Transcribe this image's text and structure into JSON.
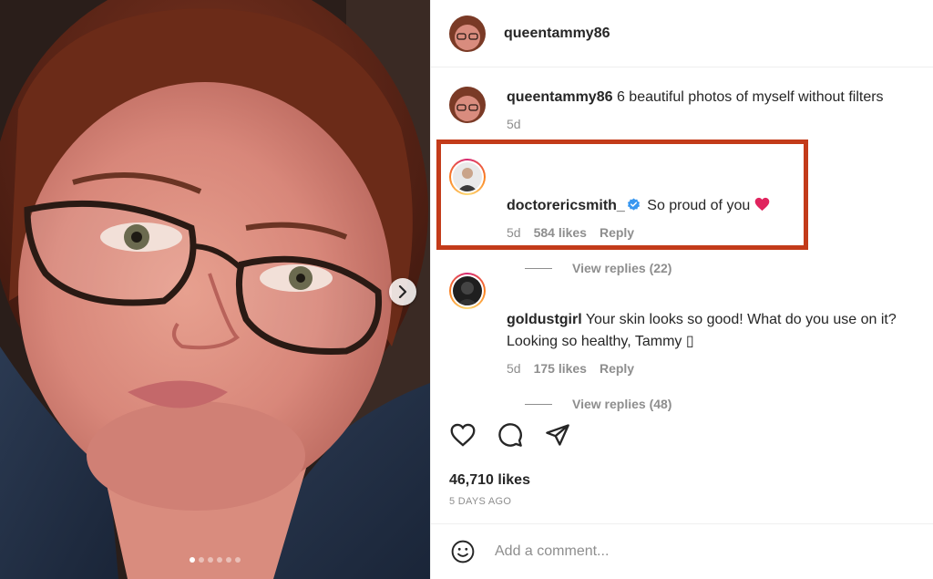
{
  "post": {
    "author": "queentammy86",
    "caption_user": "queentammy86",
    "caption_text": "6 beautiful photos of myself without filters",
    "caption_age": "5d",
    "photo_count": 6,
    "active_photo_index": 0
  },
  "comments": [
    {
      "username": "doctorericsmith_",
      "verified": true,
      "text": "So proud of you",
      "age": "5d",
      "likes": "584 likes",
      "reply_label": "Reply",
      "view_replies": "View replies (22)"
    },
    {
      "username": "goldustgirl",
      "verified": false,
      "text": "Your skin looks so good! What do you use on it? Looking so healthy, Tammy ▯",
      "age": "5d",
      "likes": "175 likes",
      "reply_label": "Reply",
      "view_replies": "View replies (48)"
    }
  ],
  "stats": {
    "likes": "46,710 likes",
    "date": "5 DAYS AGO"
  },
  "composer": {
    "placeholder": "Add a comment..."
  },
  "icons": {
    "like": "heart-icon",
    "comment": "comment-icon",
    "share": "share-icon",
    "emoji": "emoji-icon",
    "next": "chevron-right-icon",
    "verified": "verified-badge-icon"
  },
  "colors": {
    "highlight_box": "#c33b1a",
    "verified_blue": "#3897f0",
    "heart_red": "#e0245e"
  }
}
